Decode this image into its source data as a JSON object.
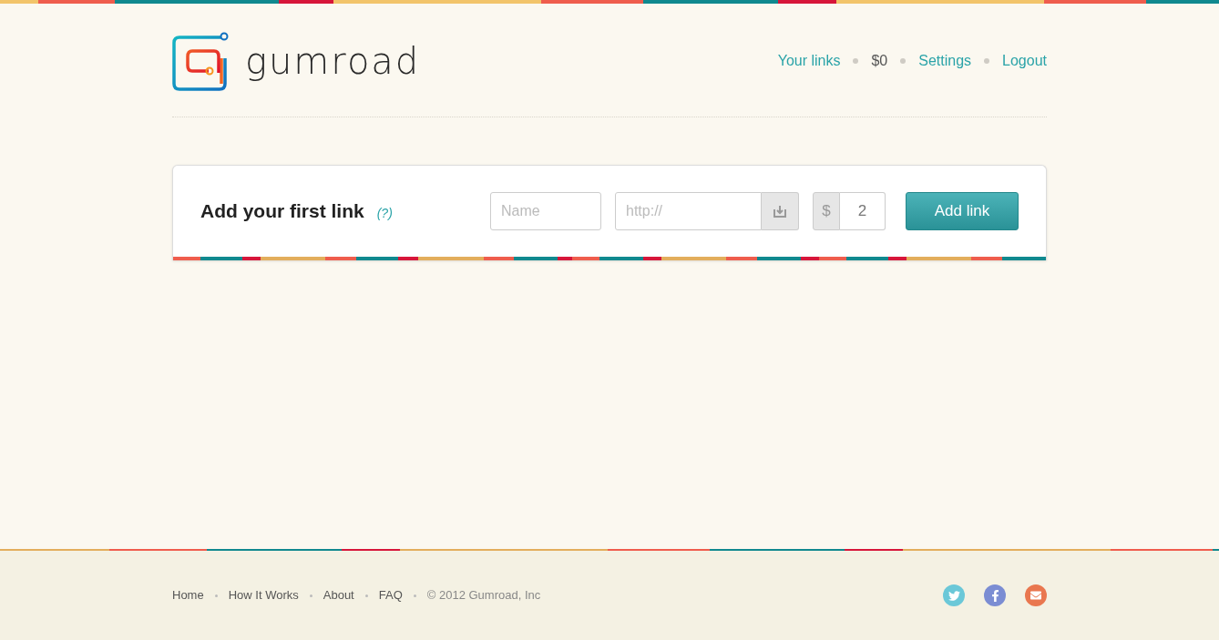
{
  "header": {
    "logo_text": "gumroad",
    "nav": [
      {
        "label": "Your links",
        "kind": "link"
      },
      {
        "label": "$0",
        "kind": "balance"
      },
      {
        "label": "Settings",
        "kind": "link"
      },
      {
        "label": "Logout",
        "kind": "link"
      }
    ]
  },
  "add_link": {
    "title": "Add your first link",
    "help": "(?)",
    "name_field": {
      "placeholder": "Name"
    },
    "url_field": {
      "placeholder": "http://"
    },
    "price_field": {
      "currency": "$",
      "value": "2"
    },
    "button": "Add link"
  },
  "footer": {
    "links": [
      "Home",
      "How It Works",
      "About",
      "FAQ"
    ],
    "copyright": "© 2012 Gumroad, Inc"
  }
}
